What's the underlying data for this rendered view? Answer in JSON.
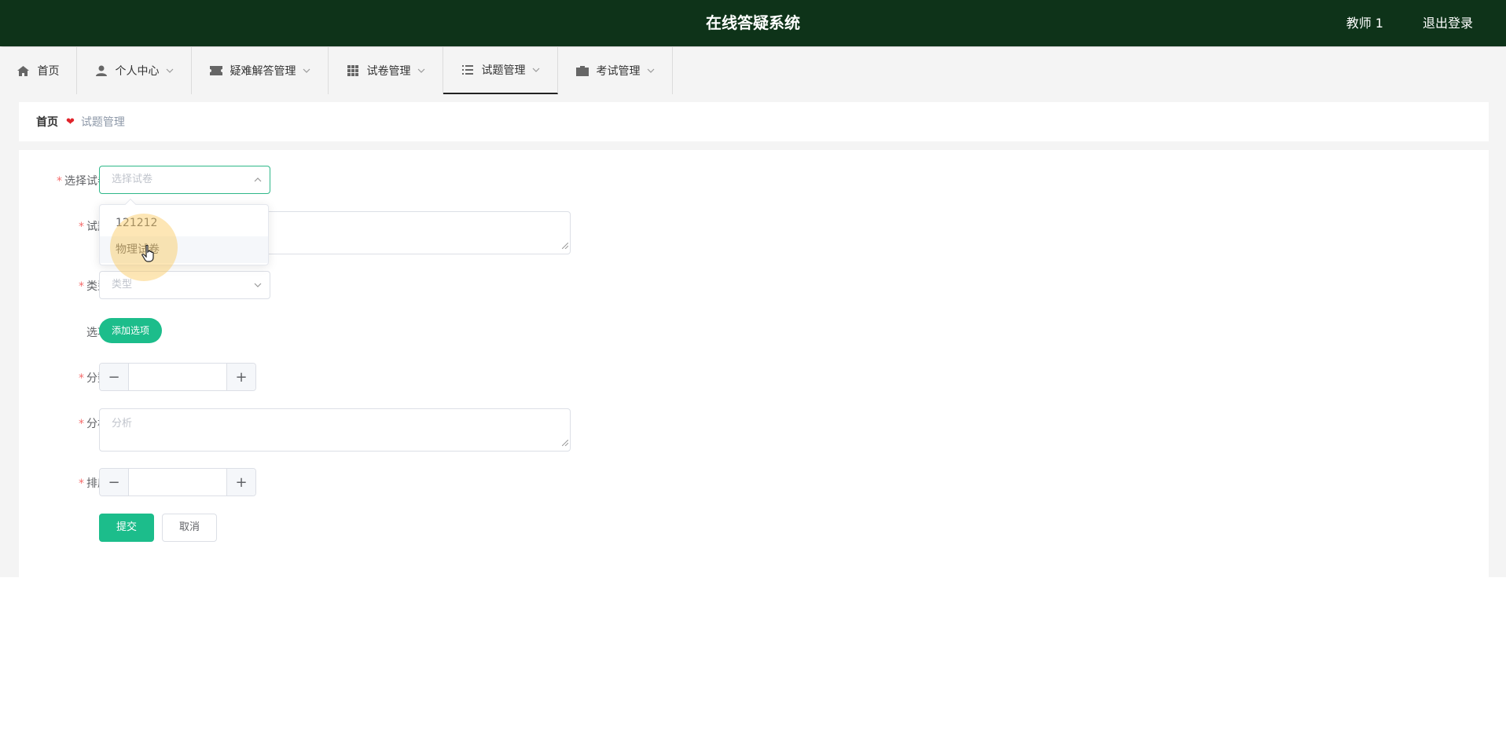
{
  "header": {
    "title": "在线答疑系统",
    "user": "教师 1",
    "logout": "退出登录"
  },
  "nav": {
    "items": [
      {
        "label": "首页",
        "icon": "home-icon"
      },
      {
        "label": "个人中心",
        "icon": "user-icon"
      },
      {
        "label": "疑难解答管理",
        "icon": "ticket-icon"
      },
      {
        "label": "试卷管理",
        "icon": "grid-icon"
      },
      {
        "label": "试题管理",
        "icon": "list-icon"
      },
      {
        "label": "考试管理",
        "icon": "briefcase-icon"
      }
    ],
    "active": "试题管理"
  },
  "breadcrumb": {
    "home": "首页",
    "current": "试题管理"
  },
  "form": {
    "paper": {
      "label": "选择试卷",
      "placeholder": "选择试卷"
    },
    "question": {
      "label": "试题"
    },
    "type": {
      "label": "类型",
      "placeholder": "类型"
    },
    "options": {
      "label": "选项",
      "add_button": "添加选项"
    },
    "score": {
      "label": "分数"
    },
    "analysis": {
      "label": "分析",
      "placeholder": "分析"
    },
    "order": {
      "label": "排序"
    },
    "submit": "提交",
    "cancel": "取消"
  },
  "dropdown": {
    "options": [
      "121212",
      "物理试卷"
    ],
    "hovered": "物理试卷"
  },
  "colors": {
    "header_bg": "#0e3319",
    "accent": "#1cbd8b",
    "required": "#f56c6c"
  }
}
